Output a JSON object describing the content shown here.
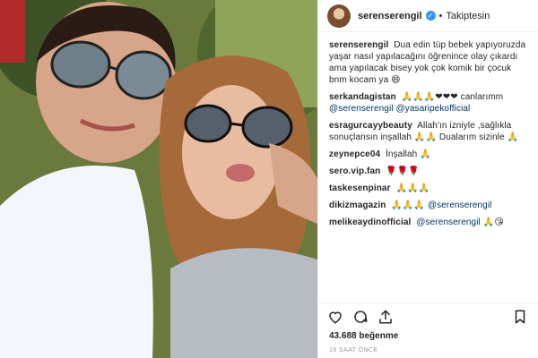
{
  "post": {
    "username": "serenserengil",
    "follow_status": "Takiptesin",
    "separator": "•",
    "caption": "Dua edin tüp bebek yapıyoruzda yaşar nasıl yapılacağını öğrenince olay çıkardı ama yapılacak bisey yok çok komik bir çocuk bnm kocam ya 😄",
    "likes": "43.688 beğenme",
    "time": "19 SAAT ÖNCE",
    "verified_badge": "✓"
  },
  "comments": [
    {
      "user": "serkandagistan",
      "text": "🙏🙏🙏❤❤❤ canlarımm",
      "mention": "@serenserengil @yasaripekofficial"
    },
    {
      "user": "esragurcayybeauty",
      "text": "Allah'ın izniyle ,sağlıkla sonuçlansın inşallah 🙏🙏 Dualarım sizinle 🙏",
      "mention": ""
    },
    {
      "user": "zeynepce04",
      "text": "İnşallah 🙏",
      "mention": ""
    },
    {
      "user": "sero.vip.fan",
      "text": "🌹🌹🌹",
      "mention": ""
    },
    {
      "user": "taskesenpinar",
      "text": "🙏🙏🙏",
      "mention": ""
    },
    {
      "user": "dikizmagazin",
      "text": "🙏🙏🙏",
      "mention": "@serenserengil"
    },
    {
      "user": "melikeaydinofficial",
      "text": "",
      "mention": "@serenserengil",
      "suffix": "🙏😘"
    }
  ],
  "icons": {
    "like": "heart-icon",
    "comment": "comment-icon",
    "share": "share-icon",
    "save": "bookmark-icon"
  },
  "colors": {
    "accent": "#3897f0",
    "mention": "#003569",
    "border": "#efefef"
  }
}
